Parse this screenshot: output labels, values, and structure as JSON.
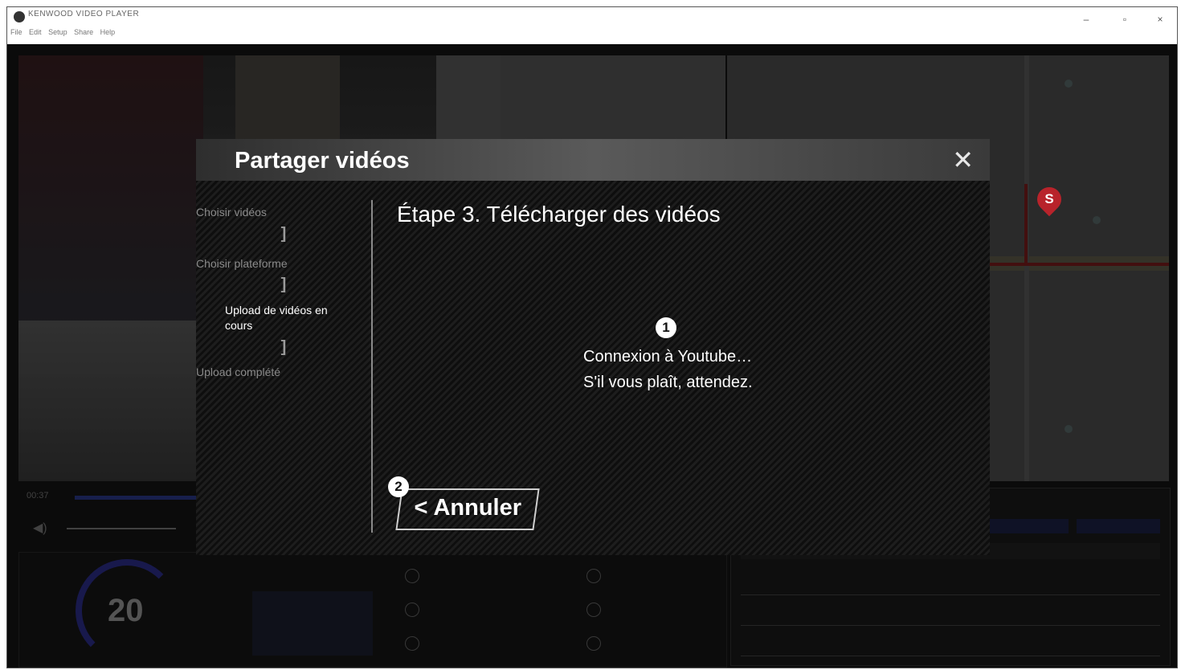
{
  "window": {
    "title": "KENWOOD VIDEO PLAYER",
    "menu": [
      "File",
      "Edit",
      "Setup",
      "Share",
      "Help"
    ],
    "controls": {
      "minimize": "–",
      "maximize": "▫",
      "close": "×"
    }
  },
  "player": {
    "time": "00:37",
    "speed": "20"
  },
  "modal": {
    "title": "Partager vidéos",
    "close_symbol": "✕",
    "steps": [
      {
        "label": "Choisir vidéos",
        "state": "done"
      },
      {
        "label": "Choisir plateforme",
        "state": "done"
      },
      {
        "label": "Upload de vidéos en cours",
        "state": "active"
      },
      {
        "label": "Upload complété",
        "state": "pending"
      }
    ],
    "step_separator": "]",
    "step_heading": "Étape 3. Télécharger des vidéos",
    "status_line1": "Connexion à Youtube…",
    "status_line2": "S'il vous plaît, attendez.",
    "callout_1": "1",
    "callout_2": "2",
    "cancel_label": "< Annuler"
  }
}
